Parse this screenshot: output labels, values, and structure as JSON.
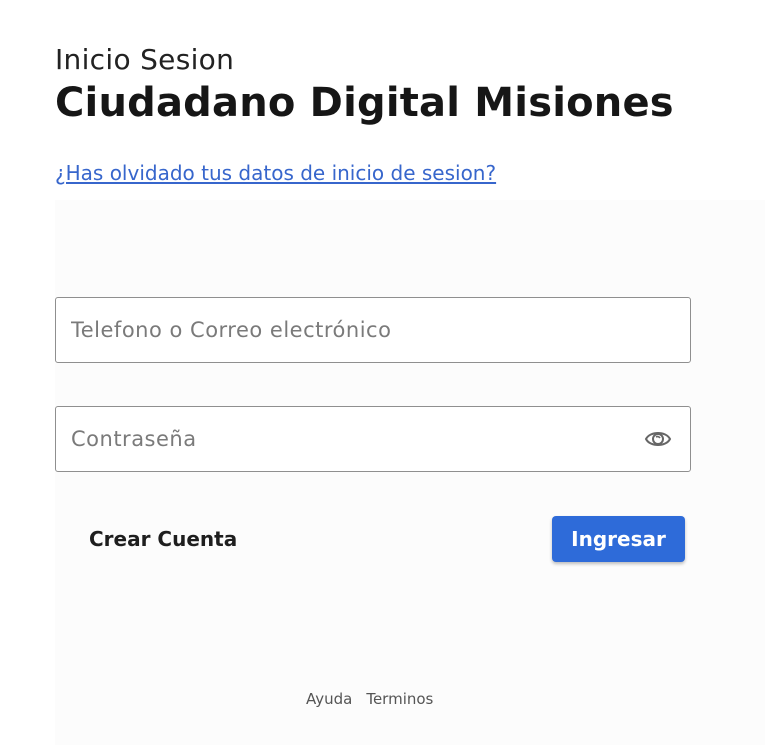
{
  "header": {
    "subtitle": "Inicio Sesion",
    "title": "Ciudadano Digital Misiones"
  },
  "forgot_link": "¿Has olvidado tus datos de inicio de sesion?",
  "form": {
    "user_placeholder": "Telefono o Correo electrónico",
    "user_value": "",
    "password_placeholder": "Contraseña",
    "password_value": "",
    "password_toggle_icon": "eye-icon"
  },
  "actions": {
    "create_account_label": "Crear Cuenta",
    "login_label": "Ingresar"
  },
  "footer": {
    "help_label": "Ayuda",
    "terms_label": "Terminos"
  },
  "colors": {
    "accent": "#2e6bd9",
    "link": "#3766cc"
  }
}
